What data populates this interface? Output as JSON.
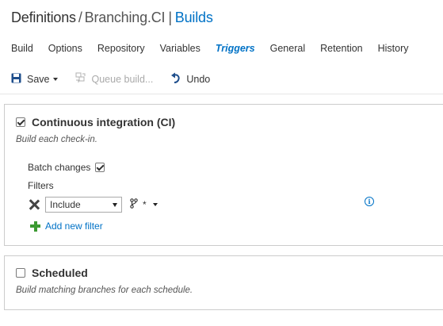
{
  "breadcrumb": {
    "root": "Definitions",
    "separator": "/",
    "definition": "Branching.CI",
    "pipe": "|",
    "section": "Builds"
  },
  "tabs": [
    {
      "label": "Build",
      "active": false
    },
    {
      "label": "Options",
      "active": false
    },
    {
      "label": "Repository",
      "active": false
    },
    {
      "label": "Variables",
      "active": false
    },
    {
      "label": "Triggers",
      "active": true
    },
    {
      "label": "General",
      "active": false
    },
    {
      "label": "Retention",
      "active": false
    },
    {
      "label": "History",
      "active": false
    }
  ],
  "toolbar": {
    "save_label": "Save",
    "queue_label": "Queue build...",
    "undo_label": "Undo"
  },
  "ci": {
    "checked": true,
    "title": "Continuous integration (CI)",
    "description": "Build each check-in.",
    "batch_label": "Batch changes",
    "batch_checked": true,
    "filters_label": "Filters",
    "filter": {
      "type_value": "Include",
      "branch_spec": "*"
    },
    "add_filter_label": "Add new filter"
  },
  "scheduled": {
    "checked": false,
    "title": "Scheduled",
    "description": "Build matching branches for each schedule."
  },
  "colors": {
    "accent": "#0072c6",
    "add_icon": "#3c9a32",
    "border": "#cccccc"
  }
}
